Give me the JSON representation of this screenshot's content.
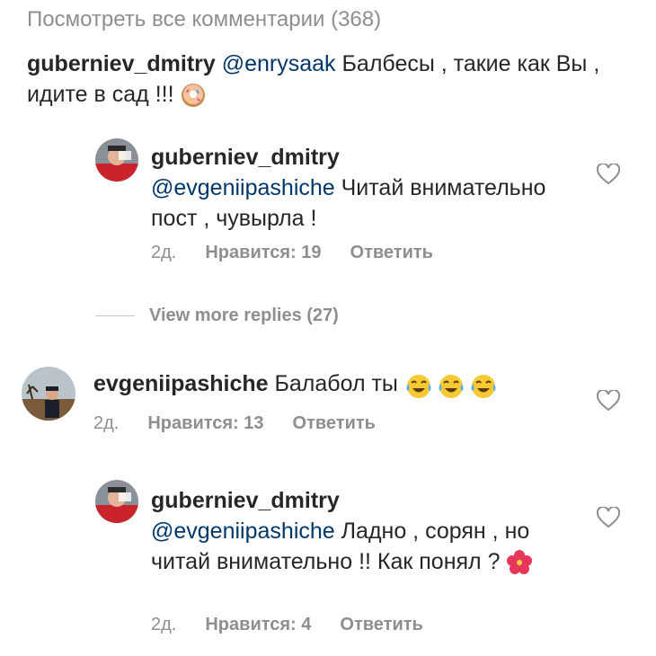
{
  "view_all_comments": "Посмотреть все комментарии (368)",
  "caption": {
    "username": "guberniev_dmitry",
    "mention": "@enrysaak",
    "text": " Балбесы , такие как Вы , идите в сад !!! ",
    "emoji": "donut-icon"
  },
  "replies": [
    {
      "username": "guberniev_dmitry",
      "mention": "@evgeniipashiche",
      "text": " Читай внимательно пост , чувырла !",
      "time": "2д.",
      "likes": "Нравится: 19",
      "reply": "Ответить"
    }
  ],
  "view_more_replies": "View more replies (27)",
  "comment": {
    "username": "evgeniipashiche",
    "text": " Балабол ты",
    "emoji": "tears-of-joy-icon",
    "time": "2д.",
    "likes": "Нравится: 13",
    "reply": "Ответить"
  },
  "reply2": {
    "username": "guberniev_dmitry",
    "mention": "@evgeniipashiche",
    "text": " Ладно , сорян , но читай внимательно !! Как понял ? ",
    "emoji": "hibiscus-icon",
    "time": "2д.",
    "likes": "Нравится: 4",
    "reply": "Ответить"
  },
  "colors": {
    "text": "#262626",
    "secondary": "#8e8e8e",
    "mention": "#00376b"
  }
}
